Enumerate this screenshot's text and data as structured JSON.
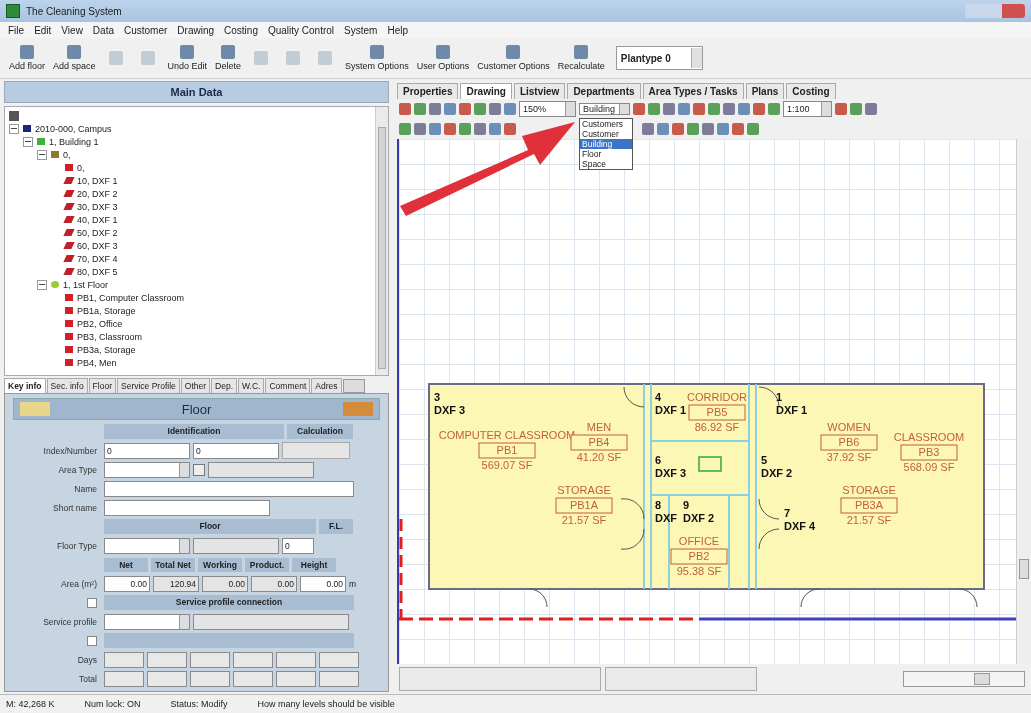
{
  "window": {
    "title": "The Cleaning System"
  },
  "menu": [
    "File",
    "Edit",
    "View",
    "Data",
    "Customer",
    "Drawing",
    "Costing",
    "Quality Control",
    "System",
    "Help"
  ],
  "toolbar": [
    {
      "label": "Add floor",
      "disabled": false
    },
    {
      "label": "Add space",
      "disabled": false
    },
    {
      "disabled": true
    },
    {
      "disabled": true
    },
    {
      "label": "Undo Edit",
      "disabled": false
    },
    {
      "label": "Delete",
      "disabled": false
    },
    {
      "disabled": true
    },
    {
      "disabled": true
    },
    {
      "disabled": true
    },
    {
      "label": "System Options",
      "disabled": false
    },
    {
      "label": "User Options",
      "disabled": false
    },
    {
      "label": "Customer Options",
      "disabled": false
    },
    {
      "label": "Recalculate",
      "disabled": false
    }
  ],
  "plantype": {
    "value": "Plantype 0"
  },
  "main_data": {
    "title": "Main Data",
    "tree": [
      {
        "label": "2010-000, Campus",
        "kind": "campus",
        "expanded": true,
        "children": [
          {
            "label": "1, Building 1",
            "kind": "building",
            "expanded": true,
            "children": [
              {
                "label": "0,",
                "kind": "level",
                "expanded": true,
                "children": [
                  {
                    "label": "0,",
                    "kind": "space"
                  },
                  {
                    "label": "10, DXF 1",
                    "kind": "dxf"
                  },
                  {
                    "label": "20, DXF 2",
                    "kind": "dxf"
                  },
                  {
                    "label": "30, DXF 3",
                    "kind": "dxf"
                  },
                  {
                    "label": "40, DXF 1",
                    "kind": "dxf"
                  },
                  {
                    "label": "50, DXF 2",
                    "kind": "dxf"
                  },
                  {
                    "label": "60, DXF 3",
                    "kind": "dxf"
                  },
                  {
                    "label": "70, DXF 4",
                    "kind": "dxf"
                  },
                  {
                    "label": "80, DXF 5",
                    "kind": "dxf"
                  }
                ]
              },
              {
                "label": "1, 1st Floor",
                "kind": "floor",
                "expanded": true,
                "children": [
                  {
                    "label": "PB1, Computer Classroom",
                    "kind": "space"
                  },
                  {
                    "label": "PB1a, Storage",
                    "kind": "space"
                  },
                  {
                    "label": "PB2, Office",
                    "kind": "space"
                  },
                  {
                    "label": "PB3, Classroom",
                    "kind": "space"
                  },
                  {
                    "label": "PB3a, Storage",
                    "kind": "space"
                  },
                  {
                    "label": "PB4, Men",
                    "kind": "space"
                  }
                ]
              }
            ]
          }
        ]
      }
    ]
  },
  "detail_tabs": [
    {
      "label": "Key info",
      "selected": true
    },
    {
      "label": "Sec. info",
      "selected": false
    },
    {
      "label": "Floor",
      "selected": false
    },
    {
      "label": "Service Profile",
      "selected": false
    },
    {
      "label": "Other",
      "selected": false
    },
    {
      "label": "Dep.",
      "selected": false
    },
    {
      "label": "W.C.",
      "selected": false
    },
    {
      "label": "Comment",
      "selected": false
    },
    {
      "label": "Adres",
      "selected": false
    }
  ],
  "form": {
    "title": "Floor",
    "identification": "Identification",
    "calculation": "Calculation",
    "index_label": "Index/Number",
    "index_values": [
      "0",
      "0"
    ],
    "area_type_label": "Area Type",
    "name_label": "Name",
    "short_name_label": "Short name",
    "floor_header": "Floor",
    "fl_header": "F.L.",
    "floor_type_label": "Floor Type",
    "fl_value": "0",
    "area_label": "Area (m²)",
    "area_columns": [
      {
        "label": "Net",
        "value": "0.00"
      },
      {
        "label": "Total Net",
        "value": "120.94"
      },
      {
        "label": "Working",
        "value": "0.00"
      },
      {
        "label": "Product.",
        "value": "0.00"
      },
      {
        "label": "Height",
        "value": "0.00"
      }
    ],
    "height_unit": "m",
    "service_header": "Service profile connection",
    "service_label": "Service profile",
    "days_label": "Days",
    "total_label": "Total"
  },
  "status_bar": [
    "M: 42,268 K",
    "Num lock: ON",
    "Status: Modify",
    "How many levels should be visible"
  ],
  "view_tabs": [
    {
      "label": "Properties",
      "selected": false
    },
    {
      "label": "Drawing",
      "selected": true
    },
    {
      "label": "Listview",
      "selected": false
    },
    {
      "label": "Departments",
      "selected": false
    },
    {
      "label": "Area Types / Tasks",
      "selected": false
    },
    {
      "label": "Plans",
      "selected": false
    },
    {
      "label": "Costing",
      "selected": false
    }
  ],
  "zoom": {
    "value": "150%"
  },
  "level_combo": {
    "value": "Building",
    "options": [
      {
        "label": "Customers",
        "selected": false
      },
      {
        "label": "Customer",
        "selected": false
      },
      {
        "label": "Building",
        "selected": true
      },
      {
        "label": "Floor",
        "selected": false
      },
      {
        "label": "Space",
        "selected": false
      }
    ]
  },
  "scale": {
    "value": "1:100"
  },
  "rooms": [
    {
      "name": "COMPUTER CLASSROOM",
      "code": "PB1",
      "area": "569.07 SF"
    },
    {
      "name": "MEN",
      "code": "PB4",
      "area": "41.20 SF"
    },
    {
      "name": "CORRIDOR",
      "code": "PB5",
      "area": "86.92 SF"
    },
    {
      "name": "WOMEN",
      "code": "PB6",
      "area": "37.92 SF"
    },
    {
      "name": "CLASSROOM",
      "code": "PB3",
      "area": "568.09 SF"
    },
    {
      "name": "STORAGE",
      "code": "PB1A",
      "area": "21.57 SF"
    },
    {
      "name": "OFFICE",
      "code": "PB2",
      "area": "95.38 SF"
    },
    {
      "name": "STORAGE",
      "code": "PB3A",
      "area": "21.57 SF"
    }
  ],
  "dxf_labels": [
    {
      "number": "3",
      "name": "DXF 3"
    },
    {
      "number": "4",
      "name": "DXF 1"
    },
    {
      "number": "1",
      "name": "DXF 1"
    },
    {
      "number": "6",
      "name": "DXF 3"
    },
    {
      "number": "5",
      "name": "DXF 2"
    },
    {
      "number": "8",
      "name": "DXF"
    },
    {
      "number": "9",
      "name": "DXF 2"
    },
    {
      "number": "7",
      "name": "DXF 4"
    }
  ]
}
